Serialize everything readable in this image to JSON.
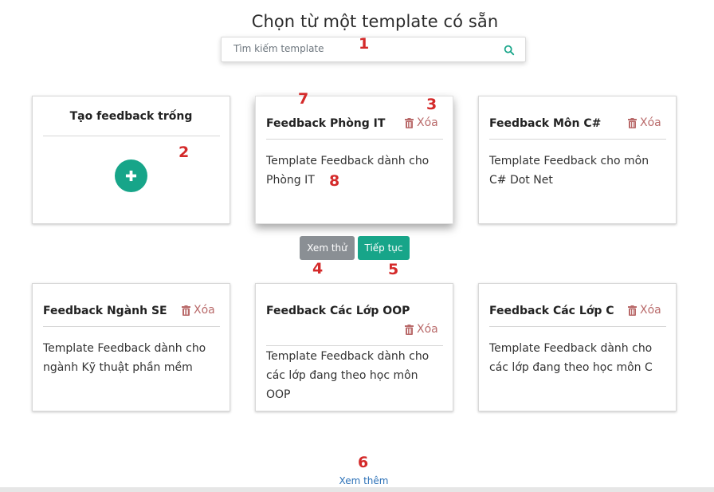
{
  "page": {
    "title": "Chọn từ một template có sẵn"
  },
  "search": {
    "placeholder": "Tìm kiếm template",
    "value": ""
  },
  "empty_card": {
    "title": "Tạo feedback trống"
  },
  "delete_label": "Xóa",
  "templates": [
    {
      "title": "Feedback Phòng IT",
      "description": "Template Feedback dành cho Phòng IT"
    },
    {
      "title": "Feedback Môn C#",
      "description": "Template Feedback cho môn C# Dot Net"
    },
    {
      "title": "Feedback Ngành SE",
      "description": "Template Feedback dành cho ngành Kỹ thuật phần mềm"
    },
    {
      "title": "Feedback Các Lớp OOP",
      "description": "Template Feedback dành cho các lớp đang theo học môn OOP"
    },
    {
      "title": "Feedback Các Lớp C",
      "description": "Template Feedback dành cho các lớp đang theo học môn C"
    }
  ],
  "actions": {
    "preview_label": "Xem thử",
    "continue_label": "Tiếp tục"
  },
  "footer": {
    "see_more_label": "Xem thêm"
  },
  "annotations": [
    "1",
    "2",
    "3",
    "4",
    "5",
    "6",
    "7",
    "8"
  ],
  "colors": {
    "accent": "#17a589",
    "secondary": "#8a8f94",
    "danger": "#b96a6a",
    "link": "#2d72b8",
    "annotation": "#d42a2a"
  },
  "icons": {
    "search": "search-icon",
    "delete": "trash-icon",
    "add": "plus-icon"
  }
}
